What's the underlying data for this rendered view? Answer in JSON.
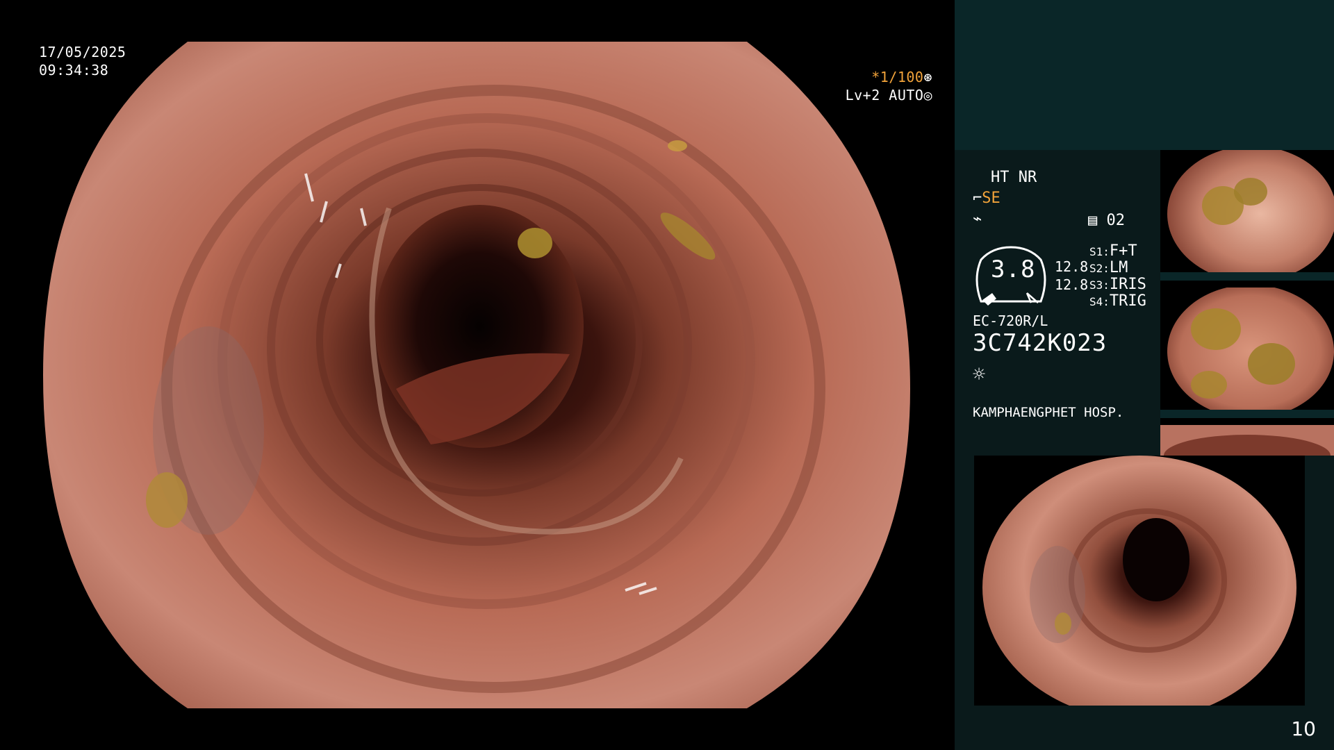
{
  "overlay": {
    "date": "17/05/2025",
    "time": "09:34:38",
    "shutter": "*1/100",
    "shutter_icon": "aperture-icon",
    "level": "Lv+2 AUTO",
    "level_icon": "iris-icon"
  },
  "info": {
    "ht_nr": "HT NR",
    "se": "SE",
    "flash_icon": "zigzag-icon",
    "memo_icon": "memo-icon",
    "count": "02",
    "gauge_value": "3.8",
    "val_top": "12.8",
    "val_bottom": "12.8",
    "s1_label": "S1:",
    "s1_value": "F+T",
    "s2_label": "S2:",
    "s2_value": "LM",
    "s3_label": "S3:",
    "s3_value": "IRIS",
    "s4_label": "S4:",
    "s4_value": "TRIG",
    "scope_model": "EC-720R/L",
    "serial": "3C742K023",
    "light_icon": "sun-icon",
    "hospital": "KAMPHAENGPHET HOSP."
  },
  "colors": {
    "accent_orange": "#f2a33a",
    "panel_teal": "#0a2628",
    "panel_dark": "#0a1a1b"
  },
  "page": {
    "number": "10"
  }
}
